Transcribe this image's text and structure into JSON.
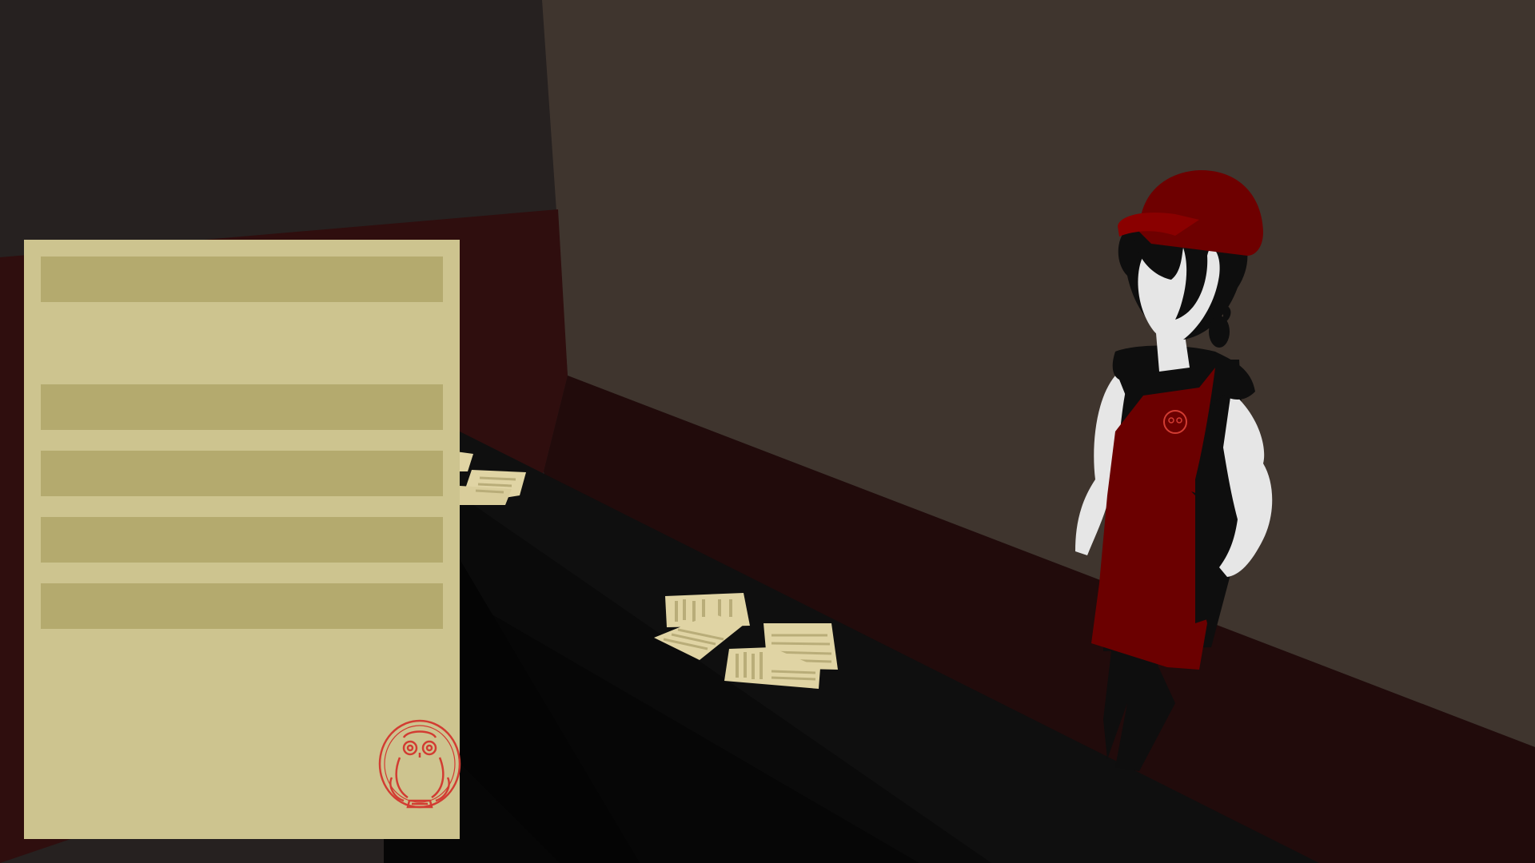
{
  "scene": {
    "title": "",
    "colors": {
      "left_wall": "#262120",
      "back_wall": "#3f352e",
      "baseboard": "#210b0b",
      "left_baseboard": "#2f0e0e",
      "counter_top": "#0f0f0f",
      "counter_side": "#060606",
      "paper": "#e0d4a4",
      "paper_lines": "#b9ad79",
      "apron": "#6b0000",
      "cap": "#6e0000",
      "skin": "#e6e6e6",
      "hair": "#0e0e0e",
      "seal_red": "#d23c32"
    }
  },
  "document": {
    "color": "#cdc48f",
    "bar_color": "#b4aa6e",
    "bars_count": 5,
    "seal_icon": "owl-seal-icon"
  },
  "character": {
    "role": "barista",
    "apron_logo": "owl-logo-icon"
  }
}
